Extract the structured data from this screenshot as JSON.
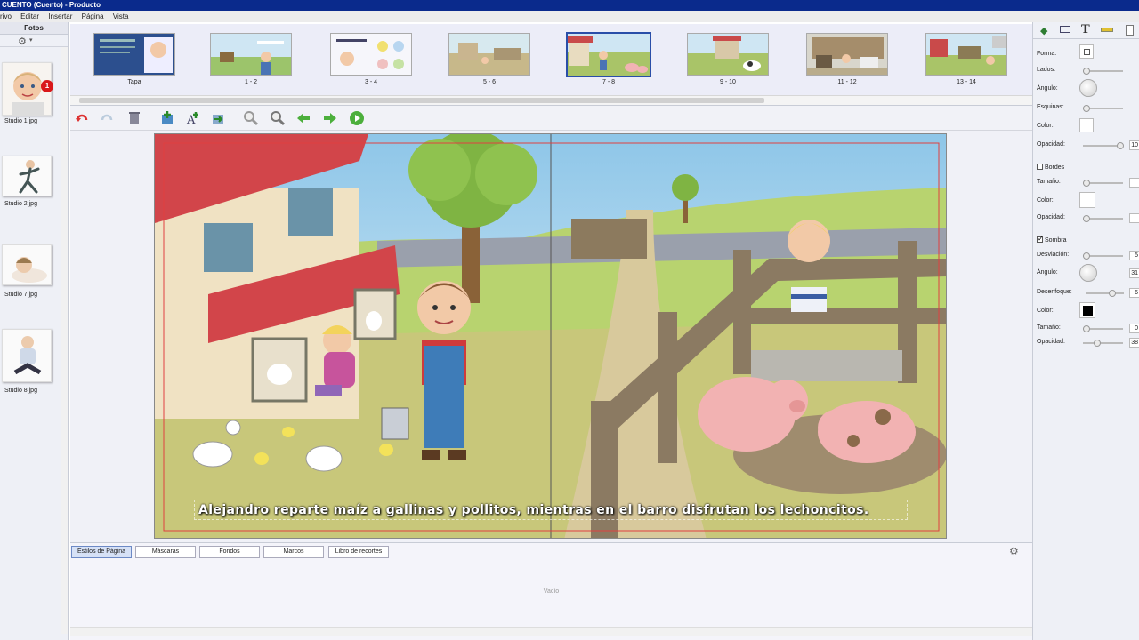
{
  "window": {
    "title": "CUENTO (Cuento) - Producto"
  },
  "menu": [
    "rivo",
    "Editar",
    "Insertar",
    "Página",
    "Vista"
  ],
  "photos": {
    "header": "Fotos",
    "badge": "1",
    "items": [
      {
        "label": "Studio 1.jpg"
      },
      {
        "label": "Studio 2.jpg"
      },
      {
        "label": "Studio 7.jpg"
      },
      {
        "label": "Studio 8.jpg"
      }
    ]
  },
  "pages": [
    {
      "label": "Tapa",
      "selected": false
    },
    {
      "label": "1 - 2",
      "selected": false
    },
    {
      "label": "3 - 4",
      "selected": false
    },
    {
      "label": "5 - 6",
      "selected": false
    },
    {
      "label": "7 - 8",
      "selected": true
    },
    {
      "label": "9 - 10",
      "selected": false
    },
    {
      "label": "11 - 12",
      "selected": false
    },
    {
      "label": "13 - 14",
      "selected": false
    }
  ],
  "toolbar_icons": [
    "undo-icon",
    "redo-icon",
    "trash-icon",
    "add-page-icon",
    "add-text-icon",
    "replace-page-icon",
    "zoom-out-icon",
    "zoom-in-icon",
    "arrow-left-icon",
    "arrow-right-icon",
    "play-icon"
  ],
  "canvas": {
    "caption": "Alejandro reparte maíz a gallinas y pollitos, mientras en el barro disfrutan los lechoncitos."
  },
  "bottom_tabs": [
    {
      "label": "Estilos de Página",
      "active": true
    },
    {
      "label": "Máscaras",
      "active": false
    },
    {
      "label": "Fondos",
      "active": false
    },
    {
      "label": "Marcos",
      "active": false
    },
    {
      "label": "Libro de recortes",
      "active": false
    }
  ],
  "bottom_empty": "Vacío",
  "props": {
    "forma": "Forma:",
    "lados": "Lados:",
    "angulo": "Ángulo:",
    "esquinas": "Esquinas:",
    "color": "Color:",
    "opacidad": "Opacidad:",
    "opacidad_val": "10",
    "bordes": "Bordes",
    "tamano": "Tamaño:",
    "color2": "Color:",
    "opacidad2": "Opacidad:",
    "sombra": "Sombra",
    "desviacion": "Desviación:",
    "desviacion_val": "5",
    "angulo2": "Ángulo:",
    "angulo2_val": "31",
    "desenfoque": "Desenfoque:",
    "desenfoque_val": "6",
    "color3": "Color:",
    "tamano2": "Tamaño:",
    "tamano2_val": "0",
    "opacidad3": "Opacidad:",
    "opacidad3_val": "38"
  }
}
